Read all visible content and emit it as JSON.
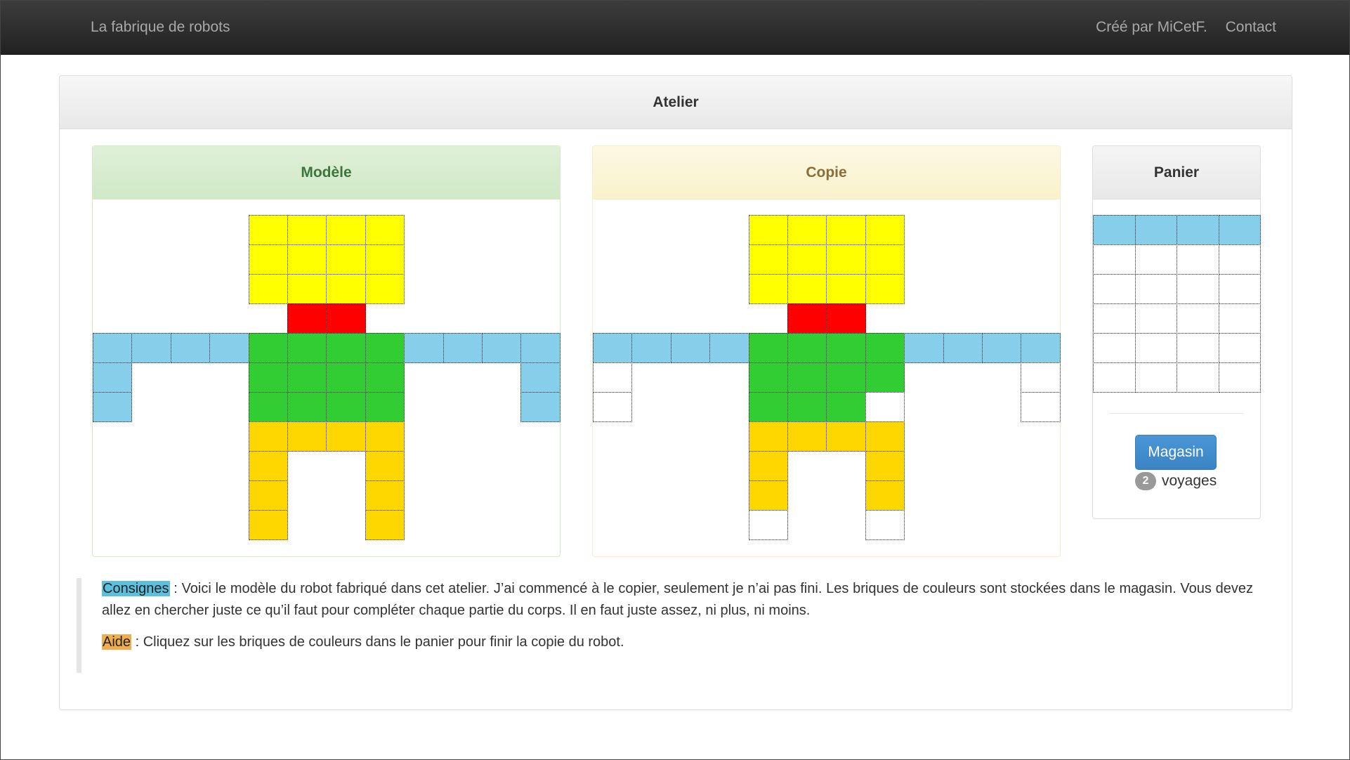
{
  "navbar": {
    "brand": "La fabrique de robots",
    "author": "Créé par MiCetF.",
    "contact": "Contact"
  },
  "workshop": {
    "title": "Atelier",
    "model_title": "Modèle",
    "copy_title": "Copie",
    "basket_title": "Panier"
  },
  "colors": {
    "Y": "#ffff00",
    "R": "#ff0000",
    "B": "#87ceeb",
    "G": "#32cd32",
    "O": "#ffd700",
    "E": "#ffffff"
  },
  "model_grid": [
    "....YYYY....",
    "....YYYY....",
    "....YYYY....",
    ".....RR.....",
    "BBBBGGGGBBBB",
    "B...GGGG...B",
    "B...GGGG...B",
    "....OOOO....",
    "....O..O....",
    "....O..O....",
    "....O..O...."
  ],
  "copy_grid": [
    "....YYYY....",
    "....YYYY....",
    "....YYYY....",
    ".....RR.....",
    "BBBBGGGGBBBB",
    "E...GGGG...E",
    "E...GGGE...E",
    "....OOOO....",
    "....O..O....",
    "....O..O....",
    "....E..E...."
  ],
  "basket_grid": [
    "BBBB",
    "EEEE",
    "EEEE",
    "EEEE",
    "EEEE",
    "EEEE"
  ],
  "shop": {
    "button_label": "Magasin",
    "trips_count": "2",
    "trips_label": "voyages"
  },
  "instructions": {
    "consignes_label": "Consignes",
    "consignes_text": " : Voici le modèle du robot fabriqué dans cet atelier. J’ai commencé à le copier, seulement je n’ai pas fini. Les briques de couleurs sont stockées dans le magasin. Vous devez allez en chercher juste ce qu’il faut pour compléter chaque partie du corps. Il en faut juste assez, ni plus, ni moins.",
    "aide_label": "Aide",
    "aide_text": " : Cliquez sur les briques de couleurs dans le panier pour finir la copie du robot."
  }
}
